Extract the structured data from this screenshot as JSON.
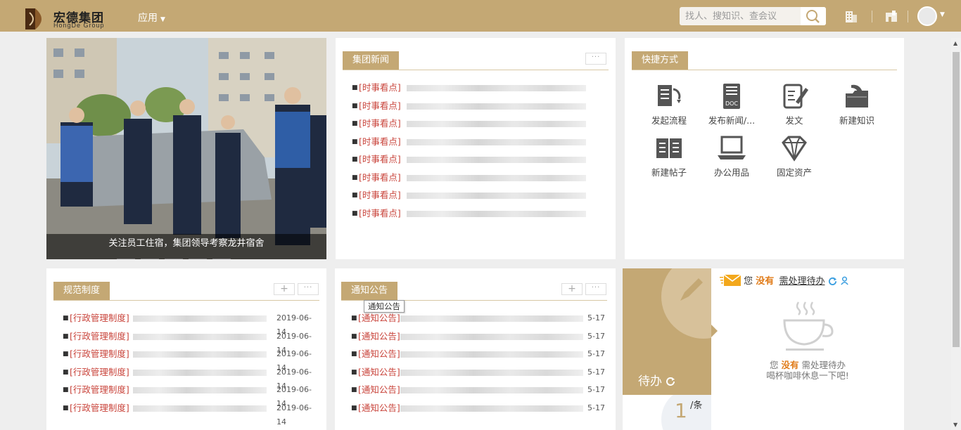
{
  "header": {
    "logo_cn": "宏德集团",
    "logo_en": "HongDe Group",
    "app_menu": "应用",
    "search_placeholder": "找人、搜知识、查会议"
  },
  "slider": {
    "caption": "关注员工住宿，集团领导考察龙井宿舍",
    "dot_count": 6,
    "active_dot": 6
  },
  "news": {
    "title": "集团新闻",
    "more": "···",
    "items": [
      {
        "tag": "[时事看点]"
      },
      {
        "tag": "[时事看点]"
      },
      {
        "tag": "[时事看点]"
      },
      {
        "tag": "[时事看点]"
      },
      {
        "tag": "[时事看点]"
      },
      {
        "tag": "[时事看点]"
      },
      {
        "tag": "[时事看点]"
      },
      {
        "tag": "[时事看点]"
      }
    ]
  },
  "shortcuts": {
    "title": "快捷方式",
    "items": [
      {
        "label": "发起流程",
        "icon": "workflow-icon"
      },
      {
        "label": "发布新闻/...",
        "icon": "doc-icon"
      },
      {
        "label": "发文",
        "icon": "edit-document-icon"
      },
      {
        "label": "新建知识",
        "icon": "folder-icon"
      },
      {
        "label": "新建帖子",
        "icon": "book-icon"
      },
      {
        "label": "办公用品",
        "icon": "laptop-icon"
      },
      {
        "label": "固定资产",
        "icon": "diamond-icon"
      }
    ]
  },
  "regulations": {
    "title": "规范制度",
    "plus": "+",
    "more": "···",
    "items": [
      {
        "tag": "[行政管理制度]",
        "date": "2019-06-14"
      },
      {
        "tag": "[行政管理制度]",
        "date": "2019-06-14"
      },
      {
        "tag": "[行政管理制度]",
        "date": "2019-06-14"
      },
      {
        "tag": "[行政管理制度]",
        "date": "2019-06-14"
      },
      {
        "tag": "[行政管理制度]",
        "date": "2019-06-14"
      },
      {
        "tag": "[行政管理制度]",
        "date": "2019-06-14"
      }
    ]
  },
  "notices": {
    "title": "通知公告",
    "tooltip": "通知公告",
    "plus": "+",
    "more": "···",
    "items": [
      {
        "tag": "[通知公告]",
        "date": "5-17"
      },
      {
        "tag": "[通知公告]",
        "date": "5-17"
      },
      {
        "tag": "[通知公告]",
        "date": "5-17"
      },
      {
        "tag": "[通知公告]",
        "date": "5-17"
      },
      {
        "tag": "[通知公告]",
        "date": "5-17"
      },
      {
        "tag": "[通知公告]",
        "date": "5-17"
      }
    ]
  },
  "todo": {
    "label": "待办",
    "count": "1",
    "unit": "/条",
    "header_prefix": "您",
    "header_none": "没有",
    "header_link": "需处理待办",
    "empty_line1_prefix": "您",
    "empty_line1_none": "没有",
    "empty_line1_suffix": "需处理待办",
    "empty_line2": "喝杯咖啡休息一下吧!"
  },
  "colors": {
    "brand": "#c4a874",
    "tag_red": "#c9453c",
    "highlight_orange": "#e07b18"
  }
}
